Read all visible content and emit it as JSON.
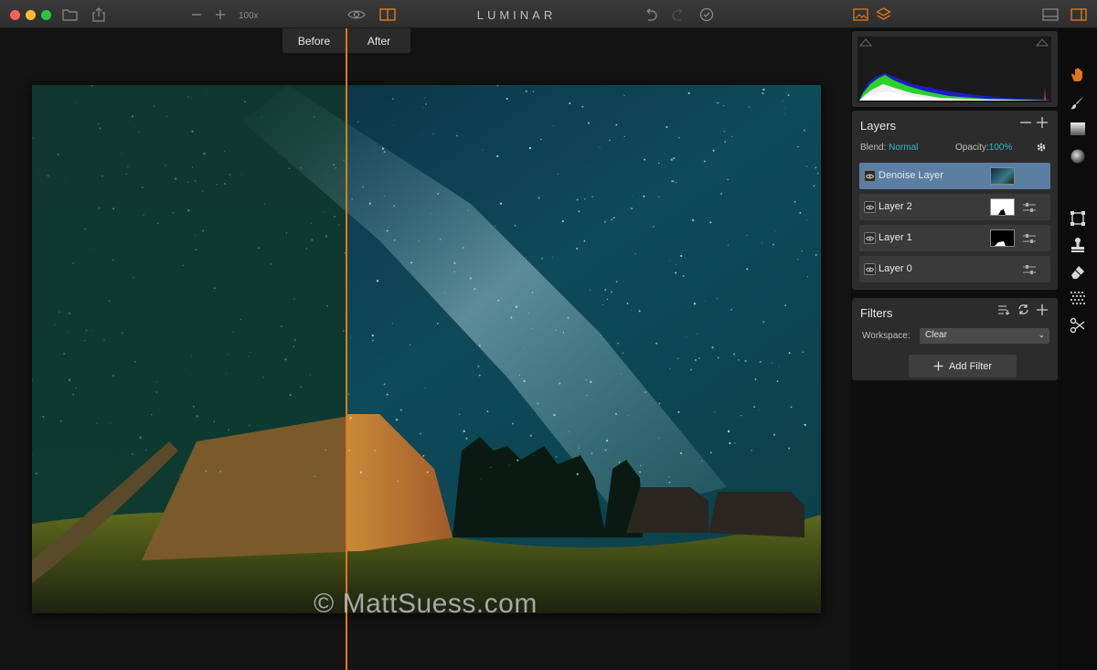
{
  "app": {
    "title": "LUMINAR"
  },
  "toolbar": {
    "zoom_level": "100x"
  },
  "compare": {
    "before_label": "Before",
    "after_label": "After",
    "split_fraction": 0.43
  },
  "watermark": "© MattSuess.com",
  "layers": {
    "title": "Layers",
    "blend_label": "Blend:",
    "blend_value": "Normal",
    "opacity_label": "Opacity:",
    "opacity_value": "100%",
    "items": [
      {
        "name": "Denoise Layer",
        "active": true,
        "thumb": "night-sky"
      },
      {
        "name": "Layer 2",
        "active": false,
        "thumb": "white-mask"
      },
      {
        "name": "Layer 1",
        "active": false,
        "thumb": "black-mask"
      },
      {
        "name": "Layer 0",
        "active": false,
        "thumb": "none"
      }
    ]
  },
  "filters": {
    "title": "Filters",
    "workspace_label": "Workspace:",
    "workspace_value": "Clear",
    "add_filter_label": "Add Filter"
  },
  "colors": {
    "accent": "#e07818",
    "teal": "#32b8c4",
    "active_layer": "#5d7ea3"
  },
  "icons": [
    "folder-icon",
    "share-icon",
    "zoom-out-icon",
    "zoom-in-icon",
    "eye-icon",
    "compare-icon",
    "undo-icon",
    "redo-icon",
    "check-icon",
    "presets-icon",
    "layers-icon",
    "single-pane-icon",
    "sidebar-icon",
    "hand-icon",
    "brush-icon",
    "gradient-icon",
    "radial-icon",
    "crop-icon",
    "stamp-icon",
    "eraser-icon",
    "noise-icon",
    "scissors-icon"
  ]
}
